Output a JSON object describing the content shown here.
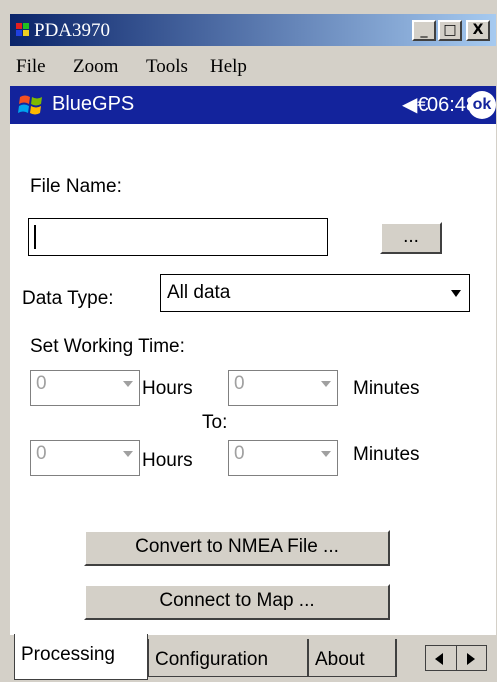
{
  "window": {
    "title": "PDA3970",
    "buttons": {
      "minimize": "_",
      "maximize": "□",
      "close": "X"
    }
  },
  "menu": {
    "file": "File",
    "zoom": "Zoom",
    "tools": "Tools",
    "help": "Help"
  },
  "navbar": {
    "app_title": "BlueGPS",
    "time": "06:48",
    "ok": "ok",
    "speaker_glyph": "◀€"
  },
  "form": {
    "file_name_label": "File Name:",
    "file_name_value": "",
    "browse_label": "...",
    "data_type_label": "Data Type:",
    "data_type_value": "All data",
    "set_time_label": "Set Working Time:",
    "from_hours": "0",
    "hours_label": "Hours",
    "from_minutes": "0",
    "minutes_label": "Minutes",
    "to_label": "To:",
    "to_hours": "0",
    "to_minutes": "0"
  },
  "actions": {
    "convert": "Convert to NMEA File ...",
    "connect": "Connect to Map ..."
  },
  "tabs": [
    {
      "label": "Processing",
      "active": true
    },
    {
      "label": "Configuration",
      "active": false
    },
    {
      "label": "About",
      "active": false
    }
  ],
  "colors": {
    "title_left": "#0a246a",
    "title_right": "#a6caf0",
    "navbar": "#13239c",
    "chrome": "#d4d0c8"
  }
}
